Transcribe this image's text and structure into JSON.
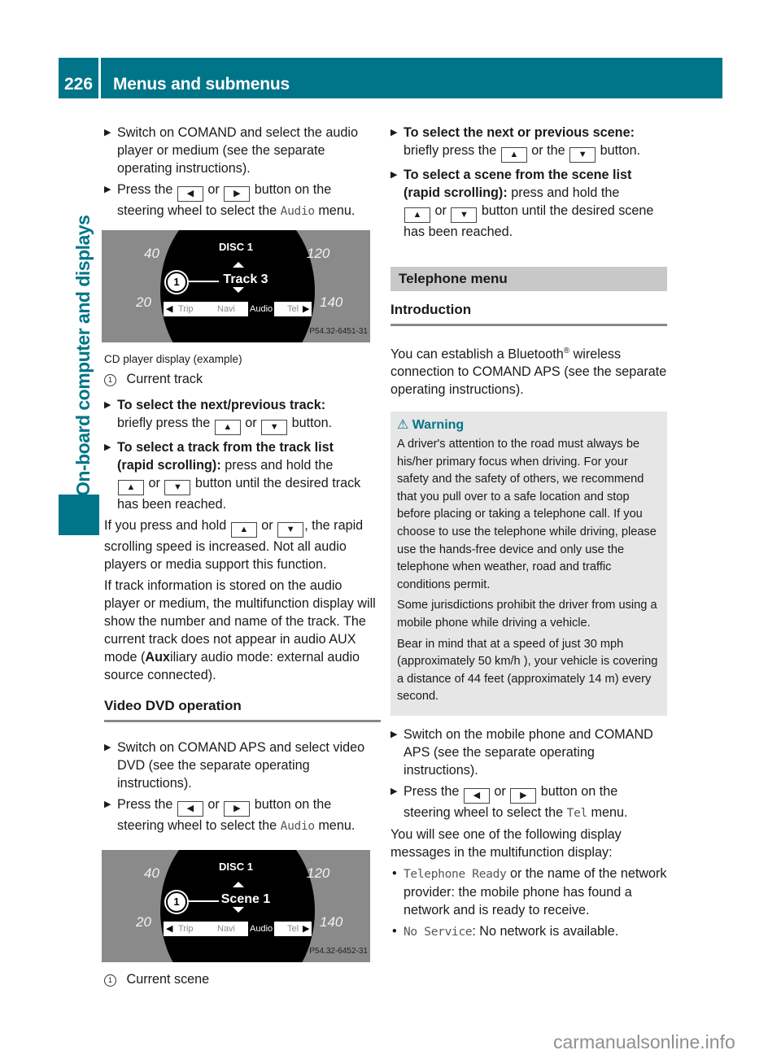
{
  "header": {
    "page_number": "226",
    "title": "Menus and submenus"
  },
  "side_tab": {
    "label": "On-board computer and displays"
  },
  "left_column": {
    "steps_audio": [
      {
        "text": "Switch on COMAND and select the audio player or medium (see the separate operating instructions)."
      },
      {
        "pre": "Press the",
        "key1": "◀",
        "mid": "or",
        "key2": "▶",
        "post": "button on the steering wheel to select the",
        "mono": "Audio",
        "end": "menu."
      }
    ],
    "cd_display": {
      "disc": "DISC 1",
      "item": "Track 3",
      "callout": "1",
      "speeds": [
        "40",
        "20",
        "120",
        "140"
      ],
      "menu": [
        "Trip",
        "Navi",
        "Audio",
        "Tel"
      ],
      "code": "P54.32-6451-31"
    },
    "cd_caption": "CD player display (example)",
    "cd_legend": {
      "num": "1",
      "label": "Current track"
    },
    "track_steps": [
      {
        "bold": "To select the next/previous track:",
        "pre": "briefly press the",
        "key1": "▲",
        "mid": "or",
        "key2": "▼",
        "post": "button."
      },
      {
        "bold": "To select a track from the track list",
        "bold2": "(rapid scrolling):",
        "pre": "press and hold the",
        "key1": "▲",
        "mid": "or",
        "key2": "▼",
        "post": "button until the desired track has been reached."
      }
    ],
    "para1": {
      "pre": "If you press and hold",
      "key1": "▲",
      "mid": "or",
      "key2": "▼",
      "post": ", the rapid scrolling speed is increased. Not all audio players or media support this function."
    },
    "para2": {
      "pre": "If track information is stored on the audio player or medium, the multifunction display will show the number and name of the track. The current track does not appear in audio AUX mode (",
      "bold": "Aux",
      "post": "iliary audio mode: external audio source connected)."
    },
    "section_video": "Video DVD operation",
    "steps_video": [
      {
        "text": "Switch on COMAND APS and select video DVD (see the separate operating instructions)."
      },
      {
        "pre": "Press the",
        "key1": "◀",
        "mid": "or",
        "key2": "▶",
        "post": "button on the steering wheel to select the",
        "mono": "Audio",
        "end": "menu."
      }
    ],
    "dvd_display": {
      "disc": "DISC 1",
      "item": "Scene 1",
      "callout": "1",
      "speeds": [
        "40",
        "20",
        "120",
        "140"
      ],
      "menu": [
        "Trip",
        "Navi",
        "Audio",
        "Tel"
      ],
      "code": "P54.32-6452-31"
    },
    "dvd_legend": {
      "num": "1",
      "label": "Current scene"
    }
  },
  "right_column": {
    "scene_steps": [
      {
        "bold": "To select the next or previous scene:",
        "pre": "briefly press the",
        "key1": "▲",
        "mid": "or the",
        "key2": "▼",
        "post": "button."
      },
      {
        "bold": "To select a scene from the scene list",
        "bold2": "(rapid scrolling):",
        "pre": "press and hold the",
        "key1": "▲",
        "mid": "or",
        "key2": "▼",
        "post": "button until the desired scene has been reached."
      }
    ],
    "section_telephone": "Telephone menu",
    "subsection_intro": "Introduction",
    "intro_text": {
      "pre": "You can establish a Bluetooth",
      "sup": "®",
      "post": " wireless connection to COMAND APS (see the separate operating instructions)."
    },
    "warning": {
      "title": "Warning",
      "paragraphs": [
        "A driver's attention to the road must always be his/her primary focus when driving. For your safety and the safety of others, we recommend that you pull over to a safe location and stop before placing or taking a telephone call. If you choose to use the telephone while driving, please use the hands-free device and only use the telephone when weather, road and traffic conditions permit.",
        "Some jurisdictions prohibit the driver from using a mobile phone while driving a vehicle.",
        "Bear in mind that at a speed of just 30 mph (approximately 50 km/h ), your vehicle is covering a distance of 44 feet (approximately 14 m) every second."
      ]
    },
    "tel_steps": [
      {
        "text": "Switch on the mobile phone and COMAND APS (see the separate operating instructions)."
      },
      {
        "pre": "Press the",
        "key1": "◀",
        "mid": "or",
        "key2": "▶",
        "post": "button on the steering wheel to select the",
        "mono": "Tel",
        "end": "menu."
      }
    ],
    "display_msg_intro": "You will see one of the following display messages in the multifunction display:",
    "messages": [
      {
        "mono": "Telephone Ready",
        "text": " or the name of the network provider: the mobile phone has found a network and is ready to receive."
      },
      {
        "mono": "No Service",
        "text": ": No network is available."
      }
    ]
  },
  "watermark": "carmanualsonline.info",
  "colors": {
    "brand": "#007489",
    "warning_bg": "#e6e6e6",
    "section_bar": "#c8c8c8"
  }
}
